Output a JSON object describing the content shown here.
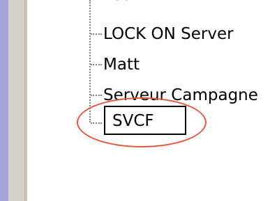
{
  "tree": {
    "items": [
      {
        "label": "Leo"
      },
      {
        "label": "LOCK ON Server"
      },
      {
        "label": "Matt"
      },
      {
        "label": "Serveur Campagne"
      },
      {
        "label": "SVCF"
      }
    ],
    "selected_index": 4
  },
  "colors": {
    "sidebar_accent": "#a7a5d9",
    "panel_grey": "#d4d0c8",
    "highlight_ring": "#e8553a",
    "tree_lines": "#808080"
  }
}
